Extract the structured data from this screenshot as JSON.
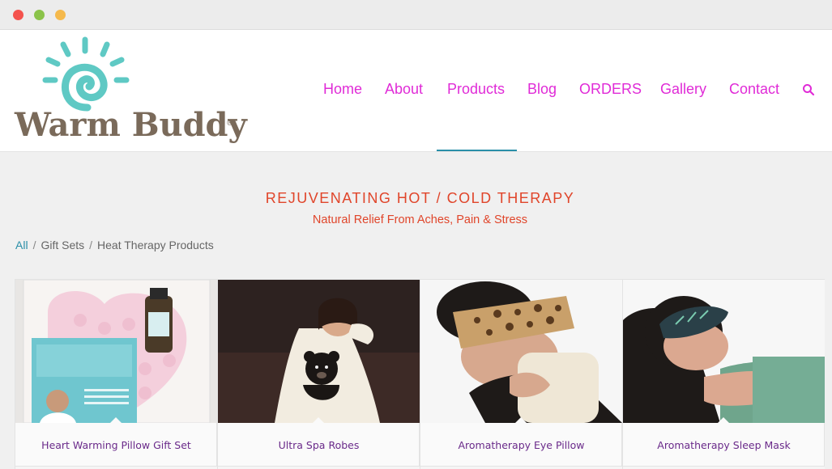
{
  "window": {
    "controls": [
      "close",
      "minimize",
      "maximize"
    ]
  },
  "header": {
    "logo_text": "Warm Buddy",
    "logo_reg": "®",
    "nav": [
      {
        "label": "Home"
      },
      {
        "label": "About"
      },
      {
        "label": "Products",
        "active": true
      },
      {
        "label": "Blog"
      },
      {
        "label": "ORDERS"
      },
      {
        "label": "Gallery"
      },
      {
        "label": "Contact"
      }
    ],
    "search_icon": "search-icon",
    "accent_color": "#e02bd7"
  },
  "hero": {
    "title": "REJUVENATING HOT / COLD THERAPY",
    "subtitle": "Natural Relief From Aches, Pain & Stress",
    "color": "#e0452a"
  },
  "filters": {
    "items": [
      "All",
      "Gift Sets",
      "Heat Therapy Products"
    ],
    "separator": "/"
  },
  "products": [
    {
      "title": "Heart Warming Pillow Gift Set"
    },
    {
      "title": "Ultra Spa Robes"
    },
    {
      "title": "Aromatherapy Eye Pillow"
    },
    {
      "title": "Aromatherapy Sleep Mask"
    }
  ]
}
